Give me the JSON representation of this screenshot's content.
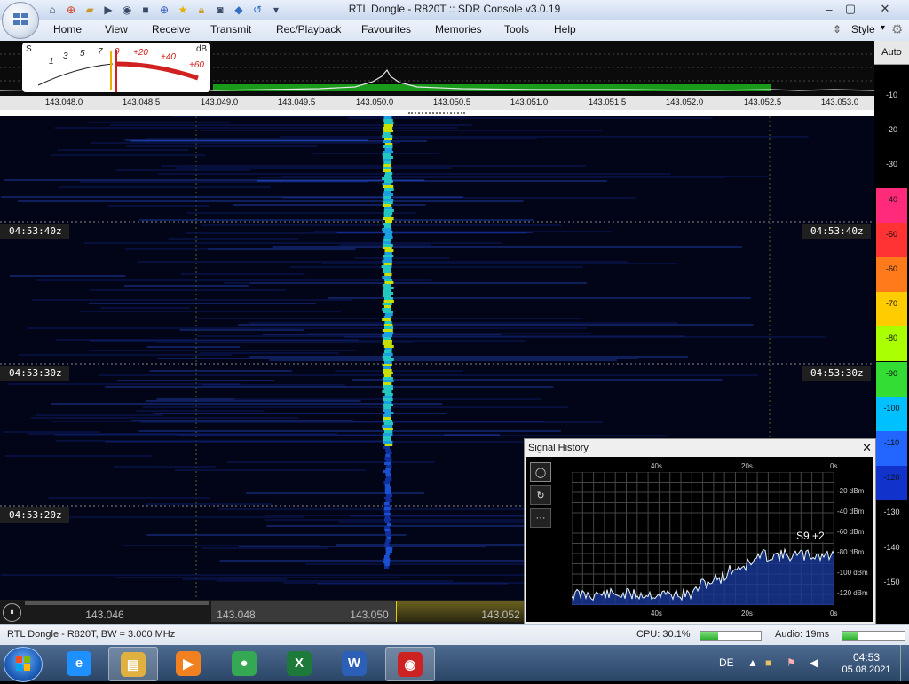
{
  "window": {
    "title": "RTL Dongle - R820T :: SDR Console v3.0.19",
    "controls": {
      "minimize": "–",
      "maximize": "▢",
      "close": "✕"
    }
  },
  "quick_access": {
    "icons": [
      "home-icon",
      "lifebuoy-icon",
      "folder-icon",
      "play-icon",
      "play-circle-icon",
      "stop-icon",
      "plus-circle-icon",
      "star-icon",
      "lock-icon",
      "camera-icon",
      "drop-icon",
      "rotate-icon",
      "dropdown-arrow-icon"
    ]
  },
  "menu": {
    "items": [
      "Home",
      "View",
      "Receive",
      "Transmit",
      "Rec/Playback",
      "Favourites",
      "Memories",
      "Tools",
      "Help"
    ],
    "style_label": "Style",
    "style_arrow": "▾"
  },
  "meter": {
    "s_label": "S",
    "db_label": "dB",
    "scale_s": [
      "1",
      "3",
      "5",
      "7",
      "9"
    ],
    "scale_db": [
      "+20",
      "+40",
      "+60"
    ]
  },
  "spectrum": {
    "freq_ticks": [
      "143.048.0",
      "143.048.5",
      "143.049.0",
      "143.049.5",
      "143.050.0",
      "143.050.5",
      "143.051.0",
      "143.051.5",
      "143.052.0",
      "143.052.5",
      "143.053.0"
    ]
  },
  "right_scale": {
    "auto_label": "Auto",
    "levels": [
      "-10",
      "-20",
      "-30",
      "-40",
      "-50",
      "-60",
      "-70",
      "-80",
      "-90",
      "-100",
      "-110",
      "-120",
      "-130",
      "-140",
      "-150"
    ],
    "colors": [
      "#000000",
      "#000000",
      "#000000",
      "#ff2a7a",
      "#ff3333",
      "#ff7a1a",
      "#ffcc00",
      "#aaff00",
      "#33dd33",
      "#00c0ff",
      "#2266ff",
      "#1133cc",
      "#000000",
      "#000000",
      "#000000"
    ]
  },
  "waterfall": {
    "time_labels": [
      "04:53:40z",
      "04:53:30z",
      "04:53:20z"
    ]
  },
  "bottom_band": {
    "play_icon": "⏸",
    "freqs": [
      "143.046",
      "143.048",
      "143.050",
      "143.052"
    ]
  },
  "signal_history": {
    "title": "Signal History",
    "close": "✕",
    "buttons": [
      "◯",
      "↻",
      "···"
    ],
    "time_ticks_top": [
      "40s",
      "20s",
      "0s"
    ],
    "time_ticks_bottom": [
      "40s",
      "20s",
      "0s"
    ],
    "dbm_ticks": [
      "-20 dBm",
      "-40 dBm",
      "-60 dBm",
      "-80 dBm",
      "-100 dBm",
      "-120 dBm"
    ],
    "current_reading": "S9 +2"
  },
  "status": {
    "left": "RTL Dongle - R820T, BW = 3.000 MHz",
    "cpu": "CPU: 30.1%",
    "cpu_level": 0.301,
    "audio": "Audio: 19ms",
    "audio_level": 0.25
  },
  "taskbar": {
    "apps": [
      {
        "name": "internet-explorer",
        "glyph": "e",
        "color": "#1e90ff"
      },
      {
        "name": "file-explorer",
        "glyph": "▤",
        "color": "#e0b040"
      },
      {
        "name": "media-player",
        "glyph": "▶",
        "color": "#f08020"
      },
      {
        "name": "chrome",
        "glyph": "●",
        "color": "#34a853"
      },
      {
        "name": "excel",
        "glyph": "X",
        "color": "#1d7a3a"
      },
      {
        "name": "word",
        "glyph": "W",
        "color": "#2b5fb8"
      },
      {
        "name": "sdr-console",
        "glyph": "◉",
        "color": "#cc2222"
      }
    ],
    "lang": "DE",
    "time": "04:53",
    "date": "05.08.2021"
  }
}
